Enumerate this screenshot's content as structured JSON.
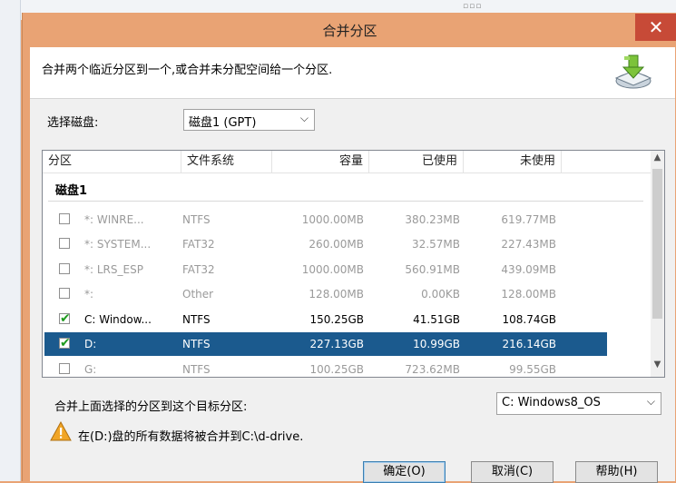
{
  "dialog": {
    "title": "合并分区",
    "close_symbol": "✕",
    "description": "合并两个临近分区到一个,或合并未分配空间给一个分区."
  },
  "disk_select": {
    "label": "选择磁盘:",
    "value": "磁盘1 (GPT)"
  },
  "table": {
    "columns": [
      "分区",
      "文件系统",
      "容量",
      "已使用",
      "未使用"
    ],
    "group_label": "磁盘1",
    "rows": [
      {
        "checked": false,
        "partition": "*: WINRE...",
        "fs": "NTFS",
        "capacity": "1000.00MB",
        "used": "380.23MB",
        "free": "619.77MB"
      },
      {
        "checked": false,
        "partition": "*: SYSTEM...",
        "fs": "FAT32",
        "capacity": "260.00MB",
        "used": "32.57MB",
        "free": "227.43MB"
      },
      {
        "checked": false,
        "partition": "*: LRS_ESP",
        "fs": "FAT32",
        "capacity": "1000.00MB",
        "used": "560.91MB",
        "free": "439.09MB"
      },
      {
        "checked": false,
        "partition": "*:",
        "fs": "Other",
        "capacity": "128.00MB",
        "used": "0.00KB",
        "free": "128.00MB"
      },
      {
        "checked": true,
        "partition": "C: Window...",
        "fs": "NTFS",
        "capacity": "150.25GB",
        "used": "41.51GB",
        "free": "108.74GB"
      },
      {
        "checked": true,
        "partition": "D:",
        "fs": "NTFS",
        "capacity": "227.13GB",
        "used": "10.99GB",
        "free": "216.14GB"
      },
      {
        "checked": false,
        "partition": "G:",
        "fs": "NTFS",
        "capacity": "100.25GB",
        "used": "723.62MB",
        "free": "99.55GB"
      }
    ]
  },
  "target": {
    "label": "合并上面选择的分区到这个目标分区:",
    "value": "C: Windows8_OS"
  },
  "warning": {
    "text": "在(D:)盘的所有数据将被合并到C:\\d-drive."
  },
  "buttons": {
    "ok": "确定(O)",
    "cancel": "取消(C)",
    "help": "帮助(H)"
  }
}
